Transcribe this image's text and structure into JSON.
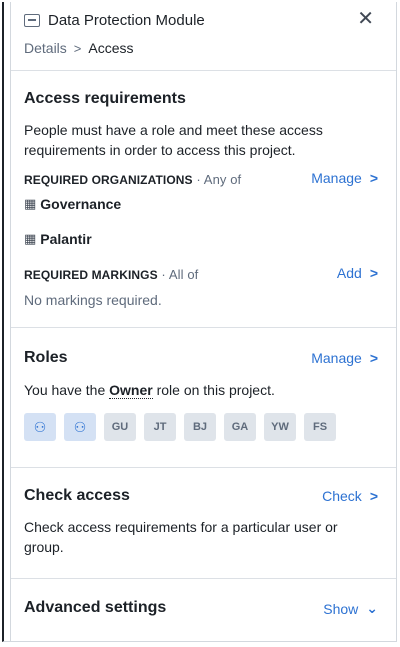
{
  "header": {
    "title": "Data Protection Module",
    "close_label": "✕",
    "breadcrumb": [
      "Details",
      "Access"
    ]
  },
  "access": {
    "title": "Access requirements",
    "description": "People must have a role and meet these access requirements in order to access this project.",
    "organizations": {
      "label": "REQUIRED ORGANIZATIONS",
      "qualifier": " · Any of",
      "action": "Manage",
      "items": [
        "Governance",
        "Palantir"
      ]
    },
    "markings": {
      "label": "REQUIRED MARKINGS",
      "qualifier": " · All of",
      "action": "Add",
      "empty": "No markings required."
    }
  },
  "roles": {
    "title": "Roles",
    "action": "Manage",
    "text_before": "You have the ",
    "role": "Owner",
    "text_after": " role on this project.",
    "avatars": [
      "GU",
      "JT",
      "BJ",
      "GA",
      "YW",
      "FS"
    ]
  },
  "check": {
    "title": "Check access",
    "action": "Check",
    "description": "Check access requirements for a particular user or group."
  },
  "advanced": {
    "title": "Advanced settings",
    "action": "Show"
  },
  "icons": {
    "module": "module-icon",
    "close": "close-icon",
    "chevron_right": "chevron-right-icon",
    "chevron_down": "chevron-down-icon",
    "organization": "building-icon",
    "user": "user-icon"
  },
  "colors": {
    "accent": "#2d72d2",
    "muted": "#5f6b7c",
    "avatar_bg": "#dfe4ea"
  }
}
